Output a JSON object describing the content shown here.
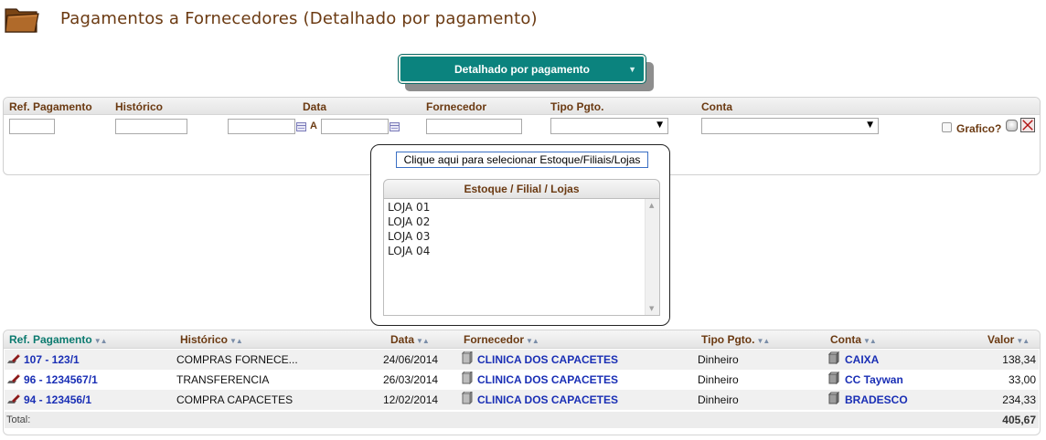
{
  "page": {
    "title": "Pagamentos a Fornecedores (Detalhado por pagamento)"
  },
  "view_select": {
    "value": "Detalhado por pagamento"
  },
  "filters": {
    "labels": {
      "ref": "Ref. Pagamento",
      "historico": "Histórico",
      "data": "Data",
      "fornecedor": "Fornecedor",
      "tipo": "Tipo Pgto.",
      "conta": "Conta"
    },
    "date_separator": "A",
    "grafico_label": "Grafico?",
    "values": {
      "ref": "",
      "historico": "",
      "data_from": "",
      "data_to": "",
      "fornecedor": "",
      "tipo": "",
      "conta": ""
    }
  },
  "estoque": {
    "button_label": "Clique aqui para selecionar Estoque/Filiais/Lojas",
    "header": "Estoque / Filial / Lojas",
    "items": [
      "LOJA 01",
      "LOJA 02",
      "LOJA 03",
      "LOJA 04"
    ]
  },
  "table": {
    "columns": {
      "ref": "Ref. Pagamento",
      "historico": "Histórico",
      "data": "Data",
      "fornecedor": "Fornecedor",
      "tipo": "Tipo Pgto.",
      "conta": "Conta",
      "valor": "Valor"
    },
    "sort_glyph": "▼▲",
    "rows": [
      {
        "ref": "107 - 123/1",
        "historico": "COMPRAS FORNECE...",
        "data": "24/06/2014",
        "fornecedor": "CLINICA DOS CAPACETES",
        "tipo": "Dinheiro",
        "conta": "CAIXA",
        "valor": "138,34"
      },
      {
        "ref": "96 - 1234567/1",
        "historico": "TRANSFERENCIA",
        "data": "26/03/2014",
        "fornecedor": "CLINICA DOS CAPACETES",
        "tipo": "Dinheiro",
        "conta": "CC Taywan",
        "valor": "33,00"
      },
      {
        "ref": "94 - 123456/1",
        "historico": "COMPRA CAPACETES",
        "data": "12/02/2014",
        "fornecedor": "CLINICA DOS CAPACETES",
        "tipo": "Dinheiro",
        "conta": "BRADESCO",
        "valor": "234,33"
      }
    ],
    "total_label": "Total:",
    "total_value": "405,67"
  },
  "colors": {
    "accent": "#0b837e",
    "label_brown": "#6b3a12",
    "link_blue": "#1a2fb5"
  },
  "icons": [
    "folder-icon",
    "dropdown-arrow-icon",
    "calendar-icon",
    "edit-payment-icon",
    "supplier-box-icon",
    "account-box-icon",
    "clear-filter-icon"
  ]
}
